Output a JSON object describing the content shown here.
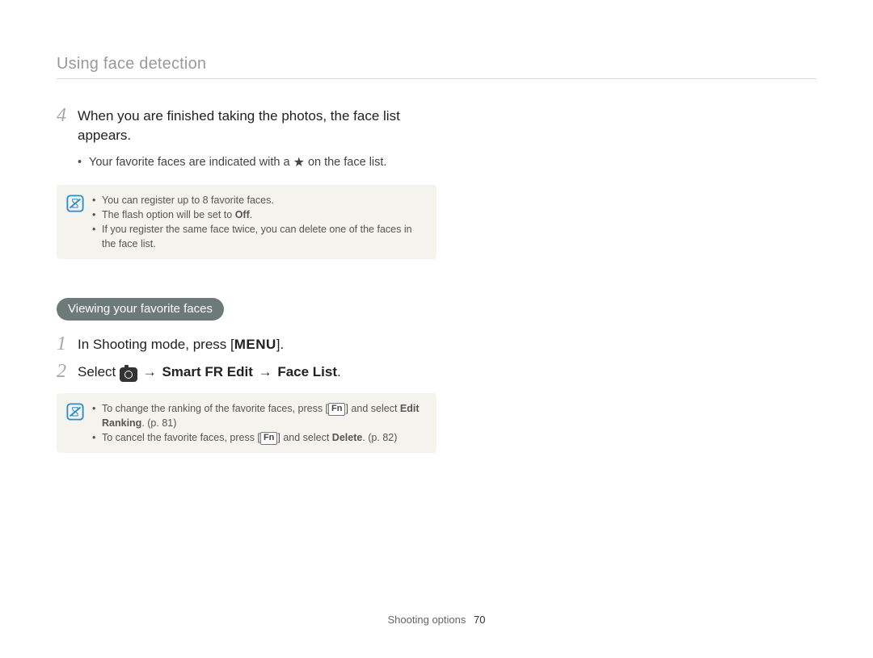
{
  "header": {
    "title": "Using face detection"
  },
  "step4": {
    "num": "4",
    "text": "When you are finished taking the photos, the face list appears.",
    "bullet_pre": "Your favorite faces are indicated with a ",
    "bullet_post": " on the face list."
  },
  "note1": {
    "items": {
      "a": "You can register up to 8 favorite faces.",
      "b_pre": "The flash option will be set to ",
      "b_bold": "Off",
      "b_post": ".",
      "c": "If you register the same face twice, you can delete one of the faces in the face list."
    }
  },
  "section_pill": "Viewing your favorite faces",
  "step1": {
    "num": "1",
    "pre": "In Shooting mode, press [",
    "menu": "MENU",
    "post": "]."
  },
  "step2": {
    "num": "2",
    "pre": "Select ",
    "arrow1": "→",
    "part1": "Smart FR Edit",
    "arrow2": "→",
    "part2": "Face List",
    "post": "."
  },
  "note2": {
    "items": {
      "a_pre": "To change the ranking of the favorite faces, press [",
      "a_fn": "Fn",
      "a_mid": "] and select ",
      "a_bold": "Edit Ranking",
      "a_post": ". (p. 81)",
      "b_pre": "To cancel the favorite faces, press [",
      "b_fn": "Fn",
      "b_mid": "] and select ",
      "b_bold": "Delete",
      "b_post": ". (p. 82)"
    }
  },
  "footer": {
    "label": "Shooting options",
    "page": "70"
  }
}
